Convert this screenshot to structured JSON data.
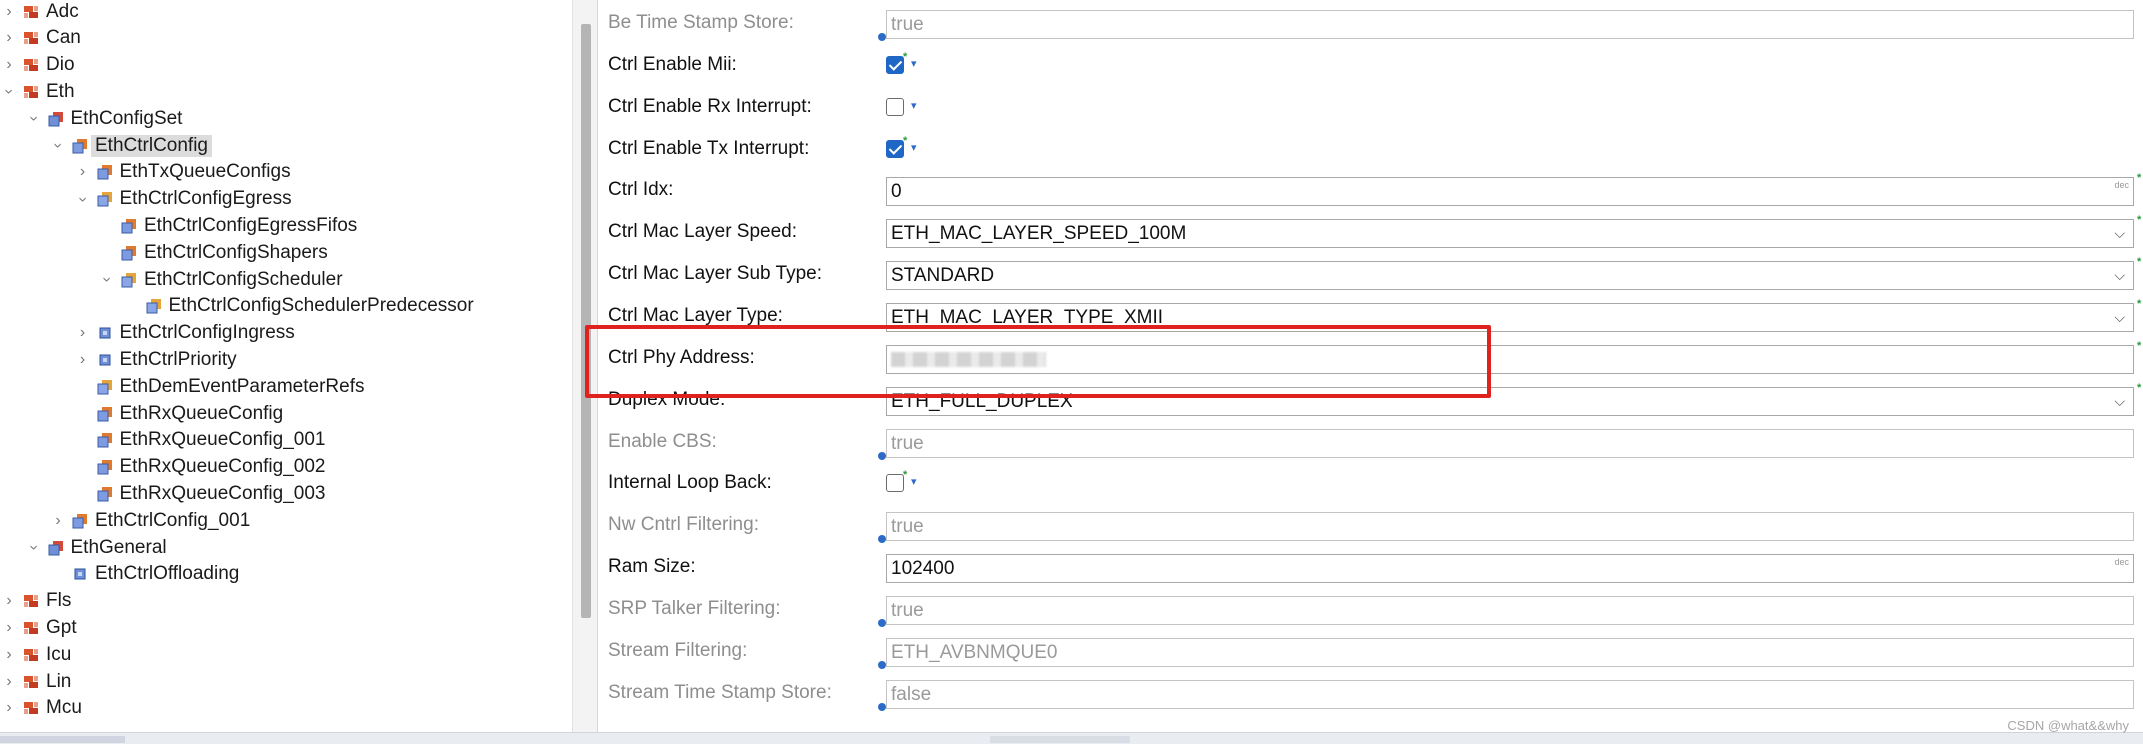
{
  "tree": {
    "items": [
      {
        "label": "Adc",
        "depth": 0,
        "expander": "collapsed",
        "icon": "module-icon"
      },
      {
        "label": "Can",
        "depth": 0,
        "expander": "collapsed",
        "icon": "module-icon"
      },
      {
        "label": "Dio",
        "depth": 0,
        "expander": "collapsed",
        "icon": "module-icon"
      },
      {
        "label": "Eth",
        "depth": 0,
        "expander": "expanded",
        "icon": "module-icon"
      },
      {
        "label": "EthConfigSet",
        "depth": 1,
        "expander": "expanded",
        "icon": "container-icon"
      },
      {
        "label": "EthCtrlConfig",
        "depth": 2,
        "expander": "expanded",
        "icon": "container-list-icon",
        "selected": true
      },
      {
        "label": "EthTxQueueConfigs",
        "depth": 3,
        "expander": "collapsed",
        "icon": "container-list-icon"
      },
      {
        "label": "EthCtrlConfigEgress",
        "depth": 3,
        "expander": "expanded",
        "icon": "container-single-icon"
      },
      {
        "label": "EthCtrlConfigEgressFifos",
        "depth": 4,
        "expander": "none",
        "icon": "container-list-icon"
      },
      {
        "label": "EthCtrlConfigShapers",
        "depth": 4,
        "expander": "none",
        "icon": "container-list-icon"
      },
      {
        "label": "EthCtrlConfigScheduler",
        "depth": 4,
        "expander": "expanded",
        "icon": "container-single-icon"
      },
      {
        "label": "EthCtrlConfigSchedulerPredecessor",
        "depth": 5,
        "expander": "none",
        "icon": "container-single-icon"
      },
      {
        "label": "EthCtrlConfigIngress",
        "depth": 3,
        "expander": "collapsed",
        "icon": "container-blue-icon"
      },
      {
        "label": "EthCtrlPriority",
        "depth": 3,
        "expander": "collapsed",
        "icon": "container-blue-icon"
      },
      {
        "label": "EthDemEventParameterRefs",
        "depth": 3,
        "expander": "none",
        "icon": "container-single-icon"
      },
      {
        "label": "EthRxQueueConfig",
        "depth": 3,
        "expander": "none",
        "icon": "container-list-icon"
      },
      {
        "label": "EthRxQueueConfig_001",
        "depth": 3,
        "expander": "none",
        "icon": "container-list-icon"
      },
      {
        "label": "EthRxQueueConfig_002",
        "depth": 3,
        "expander": "none",
        "icon": "container-list-icon"
      },
      {
        "label": "EthRxQueueConfig_003",
        "depth": 3,
        "expander": "none",
        "icon": "container-list-icon"
      },
      {
        "label": "EthCtrlConfig_001",
        "depth": 2,
        "expander": "collapsed",
        "icon": "container-list-icon"
      },
      {
        "label": "EthGeneral",
        "depth": 1,
        "expander": "expanded",
        "icon": "container-icon"
      },
      {
        "label": "EthCtrlOffloading",
        "depth": 2,
        "expander": "none",
        "icon": "container-blue-icon"
      },
      {
        "label": "Fls",
        "depth": 0,
        "expander": "collapsed",
        "icon": "module-icon"
      },
      {
        "label": "Gpt",
        "depth": 0,
        "expander": "collapsed",
        "icon": "module-icon"
      },
      {
        "label": "Icu",
        "depth": 0,
        "expander": "collapsed",
        "icon": "module-icon"
      },
      {
        "label": "Lin",
        "depth": 0,
        "expander": "collapsed",
        "icon": "module-icon"
      },
      {
        "label": "Mcu",
        "depth": 0,
        "expander": "collapsed",
        "icon": "module-icon"
      }
    ]
  },
  "form": {
    "rows": [
      {
        "key": "be-time-stamp-store",
        "label": "Be Time Stamp Store:",
        "type": "text",
        "value": "true",
        "disabled": true,
        "info": true
      },
      {
        "key": "ctrl-enable-mii",
        "label": "Ctrl Enable Mii:",
        "type": "checkbox",
        "checked": true,
        "changed": true
      },
      {
        "key": "ctrl-enable-rx-interrupt",
        "label": "Ctrl Enable Rx Interrupt:",
        "type": "checkbox",
        "checked": false,
        "changed": false
      },
      {
        "key": "ctrl-enable-tx-interrupt",
        "label": "Ctrl Enable Tx Interrupt:",
        "type": "checkbox",
        "checked": true,
        "changed": true
      },
      {
        "key": "ctrl-idx",
        "label": "Ctrl Idx:",
        "type": "number",
        "value": "0",
        "unit": "dec",
        "required": true
      },
      {
        "key": "ctrl-mac-layer-speed",
        "label": "Ctrl Mac Layer Speed:",
        "type": "select",
        "value": "ETH_MAC_LAYER_SPEED_100M",
        "required": true
      },
      {
        "key": "ctrl-mac-layer-sub-type",
        "label": "Ctrl Mac Layer Sub Type:",
        "type": "select",
        "value": "STANDARD",
        "required": true
      },
      {
        "key": "ctrl-mac-layer-type",
        "label": "Ctrl Mac Layer Type:",
        "type": "select",
        "value": "ETH_MAC_LAYER_TYPE_XMII",
        "required": true
      },
      {
        "key": "ctrl-phy-address",
        "label": "Ctrl Phy Address:",
        "type": "blurred",
        "value": "",
        "required": true
      },
      {
        "key": "duplex-mode",
        "label": "Duplex Mode:",
        "type": "select",
        "value": "ETH_FULL_DUPLEX",
        "required": true
      },
      {
        "key": "enable-cbs",
        "label": "Enable CBS:",
        "type": "text",
        "value": "true",
        "disabled": true,
        "info": true
      },
      {
        "key": "internal-loop-back",
        "label": "Internal Loop Back:",
        "type": "checkbox",
        "checked": false,
        "changed": true
      },
      {
        "key": "nw-cntrl-filtering",
        "label": "Nw Cntrl Filtering:",
        "type": "text",
        "value": "true",
        "disabled": true,
        "info": true
      },
      {
        "key": "ram-size",
        "label": "Ram Size:",
        "type": "number",
        "value": "102400",
        "unit": "dec",
        "required": false
      },
      {
        "key": "srp-talker-filtering",
        "label": "SRP Talker Filtering:",
        "type": "text",
        "value": "true",
        "disabled": true,
        "info": true
      },
      {
        "key": "stream-filtering",
        "label": "Stream Filtering:",
        "type": "text",
        "value": "ETH_AVBNMQUE0",
        "disabled": true,
        "info": true
      },
      {
        "key": "stream-time-stamp-store",
        "label": "Stream Time Stamp Store:",
        "type": "text",
        "value": "false",
        "disabled": true,
        "info": true
      }
    ]
  },
  "watermark": "CSDN @what&&why",
  "colors": {
    "highlight": "#e0221f",
    "checkbox_on": "#1f67c6",
    "required_marker": "#2a9a3a",
    "info_marker": "#2c6bc7"
  }
}
